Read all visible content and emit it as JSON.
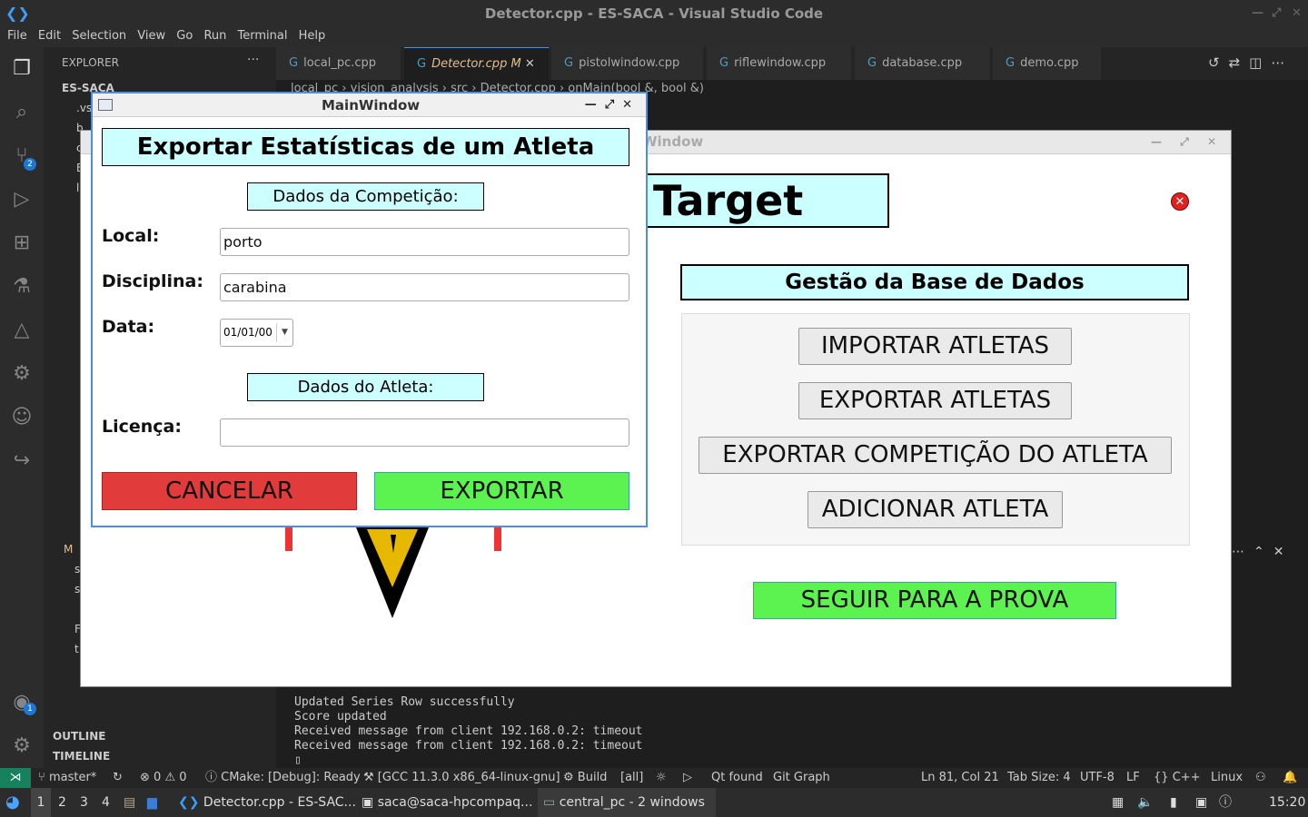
{
  "vscode": {
    "window_title": "Detector.cpp - ES-SACA - Visual Studio Code",
    "menu": [
      "File",
      "Edit",
      "Selection",
      "View",
      "Go",
      "Run",
      "Terminal",
      "Help"
    ],
    "explorer_title": "EXPLORER",
    "project": "ES-SACA",
    "sidebar_rows": [
      ".vs",
      "b",
      "c",
      "E",
      "l",
      "M",
      "s",
      "s",
      "F",
      "t"
    ],
    "outline": "OUTLINE",
    "timeline": "TIMELINE",
    "scm_badge": "2",
    "accounts_badge": "1",
    "tabs": [
      {
        "label": "local_pc.cpp"
      },
      {
        "label": "Detector.cpp",
        "suffix": "M"
      },
      {
        "label": "pistolwindow.cpp"
      },
      {
        "label": "riflewindow.cpp"
      },
      {
        "label": "database.cpp"
      },
      {
        "label": "demo.cpp"
      }
    ],
    "breadcrumb": "local_pc › vision_analysis › src › Detector.cpp › onMain(bool &, bool &)",
    "terminal_lines": [
      "Updated Series Row successfully",
      "Score updated",
      "Received message from client 192.168.0.2: timeout",
      "Received message from client 192.168.0.2: timeout"
    ],
    "status": {
      "branch": "master*",
      "problems": "0",
      "warnings": "0",
      "cmake": "CMake: [Debug]: Ready",
      "kit": "[GCC 11.3.0 x86_64-linux-gnu]",
      "build": "Build",
      "target": "[all]",
      "qt": "Qt found",
      "git_graph": "Git Graph",
      "position": "Ln 81, Col 21",
      "tab_size": "Tab Size: 4",
      "encoding": "UTF-8",
      "eol": "LF",
      "language": "C++",
      "os": "Linux"
    }
  },
  "taskbar": {
    "workspaces": [
      "1",
      "2",
      "3",
      "4"
    ],
    "windows": [
      "Detector.cpp - ES-SAC...",
      "saca@saca-hpcompaq...",
      "central_pc - 2 windows"
    ],
    "time": "15:20"
  },
  "target_window": {
    "title": "Window",
    "logo_text": "Target",
    "db_header": "Gestão da Base de Dados",
    "buttons": [
      "IMPORTAR ATLETAS",
      "EXPORTAR ATLETAS",
      "EXPORTAR COMPETIÇÃO DO ATLETA",
      "ADICIONAR ATLETA"
    ],
    "seguir": "SEGUIR PARA A PROVA"
  },
  "dialog": {
    "title": "MainWindow",
    "heading": "Exportar Estatísticas de um Atleta",
    "section_competicao": "Dados da Competição:",
    "local_label": "Local:",
    "local_value": "porto",
    "disciplina_label": "Disciplina:",
    "disciplina_value": "carabina",
    "data_label": "Data:",
    "data_value": "01/01/00",
    "section_atleta": "Dados do Atleta:",
    "licenca_label": "Licença:",
    "licenca_value": "",
    "cancel": "CANCELAR",
    "export": "EXPORTAR"
  }
}
